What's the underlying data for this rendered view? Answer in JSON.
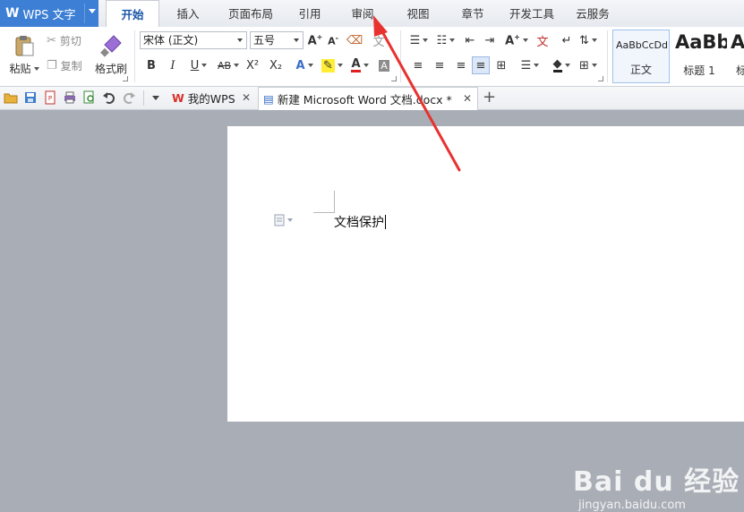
{
  "app": {
    "title": "WPS 文字",
    "accent_color": "#3c7fd4"
  },
  "menu_tabs": [
    {
      "label": "开始",
      "active": true
    },
    {
      "label": "插入"
    },
    {
      "label": "页面布局"
    },
    {
      "label": "引用"
    },
    {
      "label": "审阅"
    },
    {
      "label": "视图"
    },
    {
      "label": "章节"
    },
    {
      "label": "开发工具"
    },
    {
      "label": "云服务"
    }
  ],
  "ribbon": {
    "paste": "粘贴",
    "cut": "剪切",
    "copy": "复制",
    "format_painter": "格式刷",
    "font_name": "宋体 (正文)",
    "font_size": "五号",
    "bold": "B",
    "italic": "I",
    "underline": "U",
    "strike": "AB",
    "superscript": "X²",
    "subscript": "X₂",
    "font_color_letter": "A",
    "styles": [
      {
        "sample": "AaBbCcDd",
        "name": "正文"
      },
      {
        "sample": "AaBb",
        "name": "标题 1"
      },
      {
        "sample": "A",
        "name": "标"
      }
    ]
  },
  "doc_tabs": [
    {
      "label": "我的WPS"
    },
    {
      "label": "新建 Microsoft Word 文档.docx *",
      "active": true
    }
  ],
  "document": {
    "text": "文档保护"
  },
  "watermark": {
    "brand": "Bai du 经验",
    "url": "jingyan.baidu.com"
  },
  "annotation": {
    "color": "#e8322f",
    "target": "审阅"
  }
}
